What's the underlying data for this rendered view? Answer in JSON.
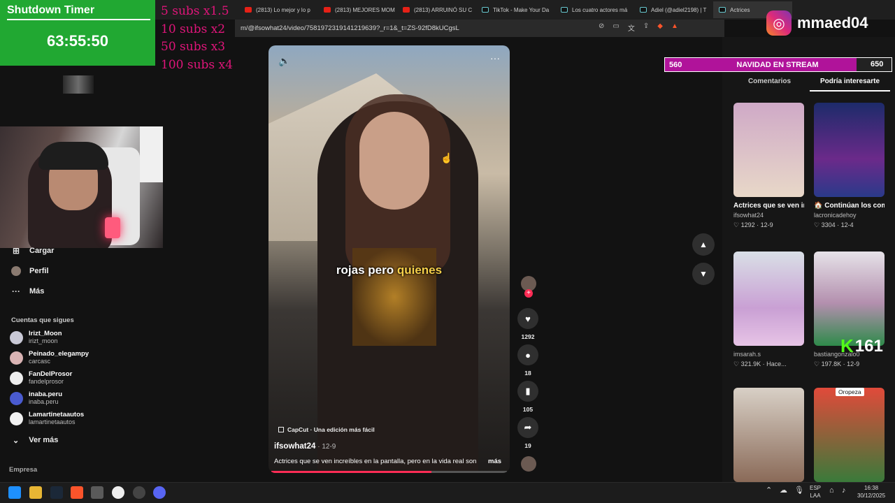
{
  "overlay": {
    "timer_title": "Shutdown Timer",
    "timer_value": "63:55:50",
    "subs_rules": [
      "5 subs x1.5",
      "10 subs x2",
      "50 subs x3",
      "100 subs x4"
    ],
    "instagram_handle": "mmaed04",
    "banner_left": "560",
    "banner_center": "NAVIDAD EN STREAM",
    "banner_right": "650",
    "kick_count": "161"
  },
  "browser": {
    "tabs": [
      {
        "label": "(2813) Lo mejor y lo p",
        "icon": "youtube-icon"
      },
      {
        "label": "(2813) MEJORES MOM",
        "icon": "youtube-icon"
      },
      {
        "label": "(2813) ARRUINÓ SU C",
        "icon": "youtube-icon"
      },
      {
        "label": "TikTok - Make Your Da",
        "icon": "tiktok-icon"
      },
      {
        "label": "Los cuatro actores má",
        "icon": "tiktok-icon"
      },
      {
        "label": "Adiel (@adiel2198) | T",
        "icon": "tiktok-icon"
      },
      {
        "label": "Actrices",
        "icon": "tiktok-icon"
      }
    ],
    "url": "m/@ifsowhat24/video/7581972319141219639?_r=1&_t=ZS-92fD8kUCgsL"
  },
  "sidebar": {
    "items": [
      {
        "label": "Cargar",
        "icon": "upload-icon"
      },
      {
        "label": "Perfil",
        "icon": "profile-icon"
      },
      {
        "label": "Más",
        "icon": "more-icon"
      }
    ],
    "following_title": "Cuentas que sigues",
    "following": [
      {
        "name": "Irizt_Moon",
        "handle": "irizt_moon",
        "color": "#c9c9d6"
      },
      {
        "name": "Peinado_elegampy",
        "handle": "carcasc",
        "color": "#d9b3b3"
      },
      {
        "name": "FanDelProsor",
        "handle": "fandelprosor",
        "color": "#eeeeee"
      },
      {
        "name": "inaba.peru",
        "handle": "inaba.peru",
        "color": "#4a5bd0"
      },
      {
        "name": "Lamartinetaautos",
        "handle": "lamartinetaautos",
        "color": "#f2f2f2"
      }
    ],
    "see_more": "Ver más",
    "company": "Empresa"
  },
  "video": {
    "caption_white": "rojas pero ",
    "caption_highlight": "quienes",
    "capcut": "CapCut · Una edición más fácil",
    "author": "ifsowhat24",
    "date": " · 12-9",
    "description": "Actrices que se ven increíbles en la pantalla, pero en la vida real son",
    "more": "más",
    "progress": 0.68
  },
  "actions": {
    "likes": "1292",
    "comments": "18",
    "saves": "105",
    "shares": "19"
  },
  "right": {
    "tabs": [
      "Comentarios",
      "Podría interesarte"
    ],
    "cards": [
      {
        "title": "Actrices que se ven increíbles en...",
        "user": "ifsowhat24",
        "stats": "♡ 1292 · 12-9",
        "color": "#d8b7a8"
      },
      {
        "title": "🏠 Continúan los comentarios sob...",
        "user": "lacronicadehoy",
        "stats": "♡ 3304 · 12-4",
        "color": "#5a2f7a"
      },
      {
        "title": "",
        "user": "imsarah.s",
        "stats": "♡ 321.9K · Hace...",
        "color": "#cfc3d6"
      },
      {
        "title": "",
        "user": "bastiangonzalo0",
        "stats": "♡ 197.8K · 12-9",
        "color": "#a9b8a6"
      },
      {
        "title": "",
        "user": "",
        "stats": "",
        "color": "#b09a88"
      },
      {
        "title": "",
        "user": "",
        "stats": "",
        "color": "#c23a2a"
      }
    ],
    "card6_badge": "Oropeza"
  },
  "taskbar": {
    "lang": "ESP",
    "lang2": "LAA",
    "time": "16:38",
    "date": "30/12/2025"
  }
}
